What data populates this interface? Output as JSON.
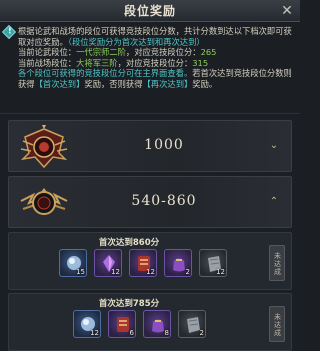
{
  "header": {
    "title": "段位奖励",
    "close_glyph": "✕"
  },
  "info": {
    "line1": "根据论武和战场的段位可获得竞技段位分数，共计分数到达以下档次即可获取对应奖励。",
    "line1_note": "（段位奖励分为首次达到和再次达到）",
    "lunwu_prefix": "当前论武段位：",
    "lunwu_rank": "一代宗师二阶",
    "lunwu_mid": "，对应竞技段位分：",
    "lunwu_score": "265",
    "zhanchang_prefix": "当前战场段位：",
    "zhanchang_rank": "大将军三阶",
    "zhanchang_mid": "，对应竞技段位分：",
    "zhanchang_score": "315",
    "line4_teal": "各个段位可获得的竞技段位分可在主界面查看。",
    "line4_rest": "若首次达到竞技段位分数则获得",
    "first_tag": "【首次达到】",
    "line4_mid": "奖励，否则获得",
    "again_tag": "【再次达到】",
    "line4_end": "奖励。"
  },
  "ranks": [
    {
      "score": "1000",
      "badge": "red-wing-badge-icon"
    },
    {
      "score": "540-860",
      "badge": "gold-wing-badge-icon"
    }
  ],
  "rewards": [
    {
      "title": "首次达到860分",
      "claim_label": "未达成",
      "items": [
        {
          "icon": "spirit-orb-icon",
          "count": "15",
          "tier": "blue"
        },
        {
          "icon": "purple-crystal-icon",
          "count": "12",
          "tier": "purple"
        },
        {
          "icon": "red-scroll-icon",
          "count": "12",
          "tier": "purple"
        },
        {
          "icon": "purple-pouch-icon",
          "count": "2",
          "tier": "purple"
        },
        {
          "icon": "stone-tablet-icon",
          "count": "12",
          "tier": "gray"
        }
      ]
    },
    {
      "title": "首次达到785分",
      "claim_label": "未达成",
      "items": [
        {
          "icon": "spirit-orb-icon",
          "count": "12",
          "tier": "blue"
        },
        {
          "icon": "red-scroll-icon",
          "count": "6",
          "tier": "purple"
        },
        {
          "icon": "purple-pouch-icon",
          "count": "8",
          "tier": "purple"
        },
        {
          "icon": "stone-tablet-icon",
          "count": "2",
          "tier": "gray"
        }
      ]
    }
  ],
  "colors": {
    "teal": "#4fc4c7",
    "green": "#8fcf5a",
    "gold": "#c9b98a"
  }
}
